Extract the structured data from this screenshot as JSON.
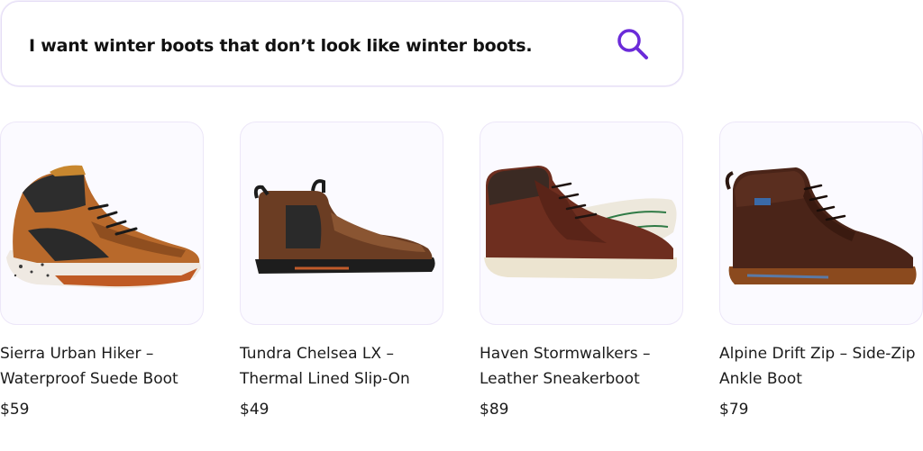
{
  "search": {
    "query": "I want winter boots that don’t look like winter boots.",
    "icon": "search-icon",
    "accent_color": "#6b2bd9"
  },
  "products": [
    {
      "title_line1": "Sierra Urban Hiker –",
      "title_line2": "Waterproof Suede Boot",
      "price": "$59"
    },
    {
      "title_line1": "Tundra Chelsea LX –",
      "title_line2": "Thermal Lined Slip-On",
      "price": "$49"
    },
    {
      "title_line1": "Haven Stormwalkers –",
      "title_line2": "Leather Sneakerboot",
      "price": "$89"
    },
    {
      "title_line1": "Alpine Drift Zip – Side-Zip",
      "title_line2": "Ankle Boot",
      "price": "$79"
    }
  ]
}
